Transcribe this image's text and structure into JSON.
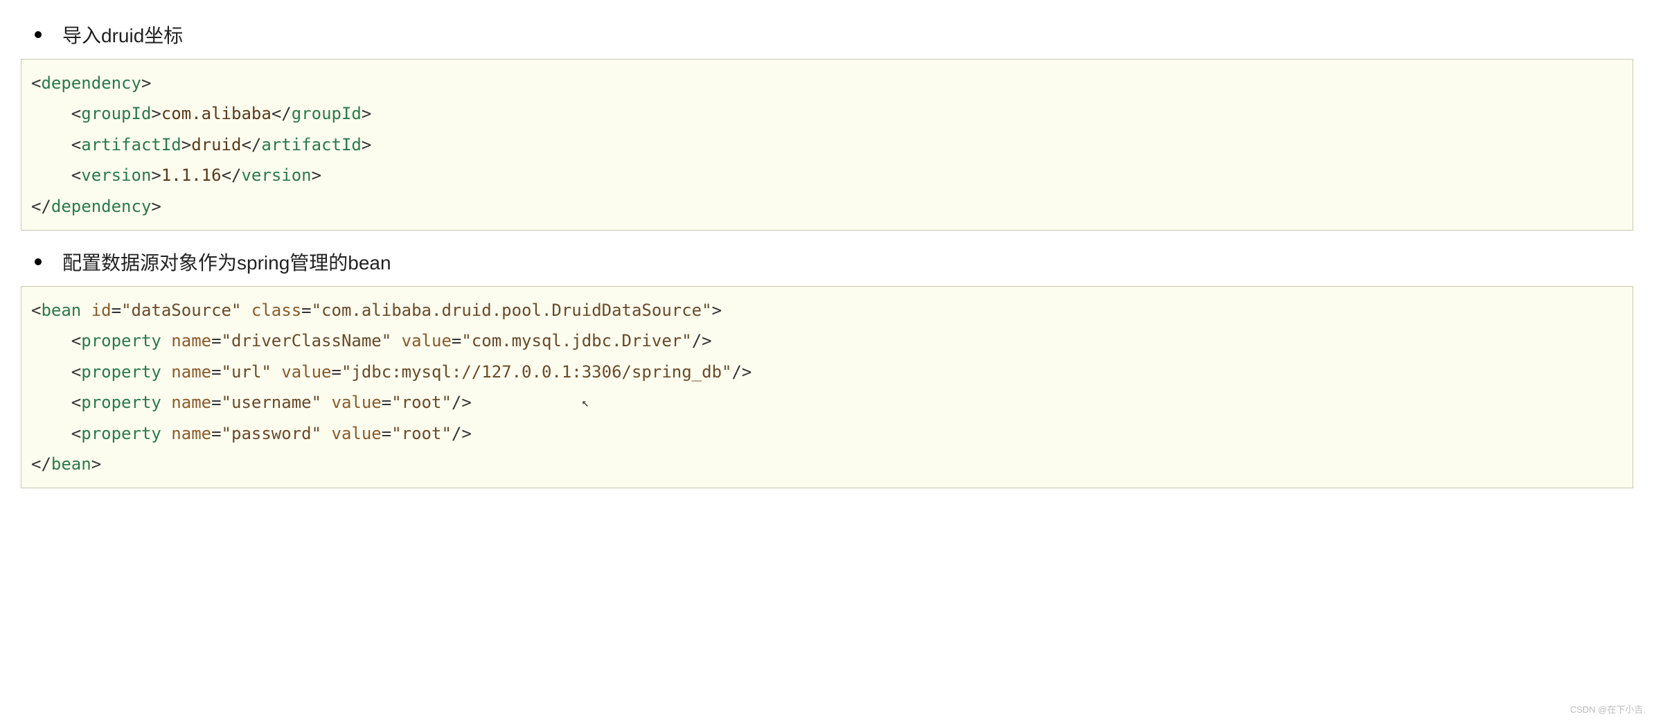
{
  "bullets": {
    "b1": "导入druid坐标",
    "b2": "配置数据源对象作为spring管理的bean"
  },
  "code1": {
    "dep_open": "dependency",
    "groupId_tag": "groupId",
    "groupId_val": "com.alibaba",
    "artifactId_tag": "artifactId",
    "artifactId_val": "druid",
    "version_tag": "version",
    "version_val": "1.1.16"
  },
  "code2": {
    "bean_tag": "bean",
    "id_attr": "id",
    "id_val": "\"dataSource\"",
    "class_attr": "class",
    "class_val": "\"com.alibaba.druid.pool.DruidDataSource\"",
    "property_tag": "property",
    "name_attr": "name",
    "value_attr": "value",
    "p1_name": "\"driverClassName\"",
    "p1_value": "\"com.mysql.jdbc.Driver\"",
    "p2_name": "\"url\"",
    "p2_value": "\"jdbc:mysql://127.0.0.1:3306/spring_db\"",
    "p3_name": "\"username\"",
    "p3_value": "\"root\"",
    "p4_name": "\"password\"",
    "p4_value": "\"root\""
  },
  "watermark": "CSDN @在下小吉."
}
